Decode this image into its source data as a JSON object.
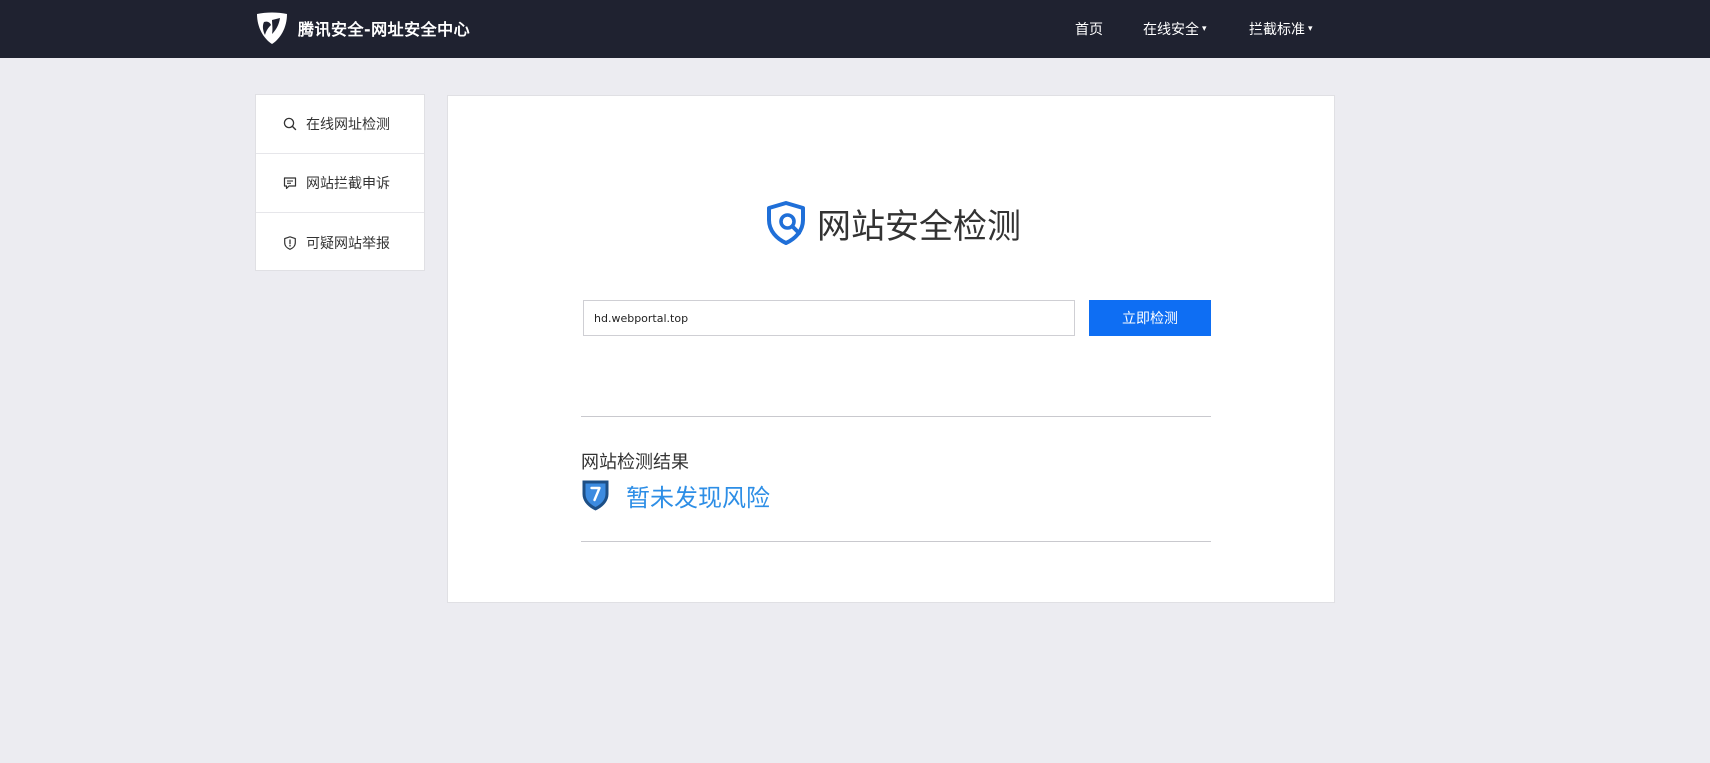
{
  "header": {
    "brand_title": "腾讯安全-网址安全中心",
    "logo_icon": "tencent-security-logo",
    "nav": [
      {
        "label": "首页",
        "has_dropdown": false
      },
      {
        "label": "在线安全",
        "has_dropdown": true
      },
      {
        "label": "拦截标准",
        "has_dropdown": true
      }
    ],
    "dropdown_caret": "▾"
  },
  "sidebar": {
    "items": [
      {
        "label": "在线网址检测",
        "icon": "search-icon"
      },
      {
        "label": "网站拦截申诉",
        "icon": "message-icon"
      },
      {
        "label": "可疑网站举报",
        "icon": "shield-alert-icon"
      }
    ]
  },
  "main": {
    "hero_title": "网站安全检测",
    "hero_icon": "shield-search-icon",
    "search": {
      "value": "hd.webportal.top",
      "placeholder": ""
    },
    "check_button_label": "立即检测",
    "result_label": "网站检测结果",
    "result_status": "暂未发现风险",
    "result_icon": "unknown-shield-icon"
  },
  "colors": {
    "topbar": "#1f2230",
    "page_bg": "#ececf1",
    "accent_button": "#0e6ef3",
    "result_text": "#2d8ee6"
  }
}
